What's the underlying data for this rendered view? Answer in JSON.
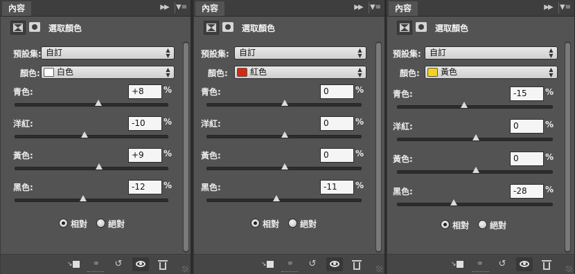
{
  "panels": [
    {
      "tab_label": "內容",
      "header_title": "選取顏色",
      "preset_label": "預設集:",
      "preset_value": "自訂",
      "colors_label": "顏色:",
      "colors_value": "白色",
      "swatch_color": "#ffffff",
      "sliders": [
        {
          "label": "青色:",
          "value": "+8",
          "level_percent": 8
        },
        {
          "label": "洋紅:",
          "value": "-10",
          "level_percent": -10
        },
        {
          "label": "黃色:",
          "value": "+9",
          "level_percent": 9
        },
        {
          "label": "黑色:",
          "value": "-12",
          "level_percent": -12
        }
      ],
      "percent_sign": "%",
      "method": {
        "relative": "相對",
        "absolute": "絕對",
        "selected": "relative"
      }
    },
    {
      "tab_label": "內容",
      "header_title": "選取顏色",
      "preset_label": "預設集:",
      "preset_value": "自訂",
      "colors_label": "顏色:",
      "colors_value": "紅色",
      "swatch_color": "#d42a10",
      "sliders": [
        {
          "label": "青色:",
          "value": "0",
          "level_percent": 0
        },
        {
          "label": "洋紅:",
          "value": "0",
          "level_percent": 0
        },
        {
          "label": "黃色:",
          "value": "0",
          "level_percent": 0
        },
        {
          "label": "黑色:",
          "value": "-11",
          "level_percent": -11
        }
      ],
      "percent_sign": "%",
      "method": {
        "relative": "相對",
        "absolute": "絕對",
        "selected": "relative"
      }
    },
    {
      "tab_label": "內容",
      "header_title": "選取顏色",
      "preset_label": "預設集:",
      "preset_value": "自訂",
      "colors_label": "顏色:",
      "colors_value": "黃色",
      "swatch_color": "#f5d21e",
      "sliders": [
        {
          "label": "青色:",
          "value": "-15",
          "level_percent": -15
        },
        {
          "label": "洋紅:",
          "value": "0",
          "level_percent": 0
        },
        {
          "label": "黃色:",
          "value": "0",
          "level_percent": 0
        },
        {
          "label": "黑色:",
          "value": "-28",
          "level_percent": -28
        }
      ],
      "percent_sign": "%",
      "method": {
        "relative": "相對",
        "absolute": "絕對",
        "selected": "relative"
      }
    }
  ],
  "icons": {
    "collapse": "double-chevron-right-icon",
    "menu": "panel-menu-icon",
    "clip": "clip-to-layer-icon",
    "view_previous": "view-previous-state-icon",
    "reset": "reset-icon",
    "visibility": "eye-icon",
    "delete": "trash-icon"
  },
  "colors": {
    "panel_bg": "#535353",
    "input_bg": "#f5f5f5"
  }
}
